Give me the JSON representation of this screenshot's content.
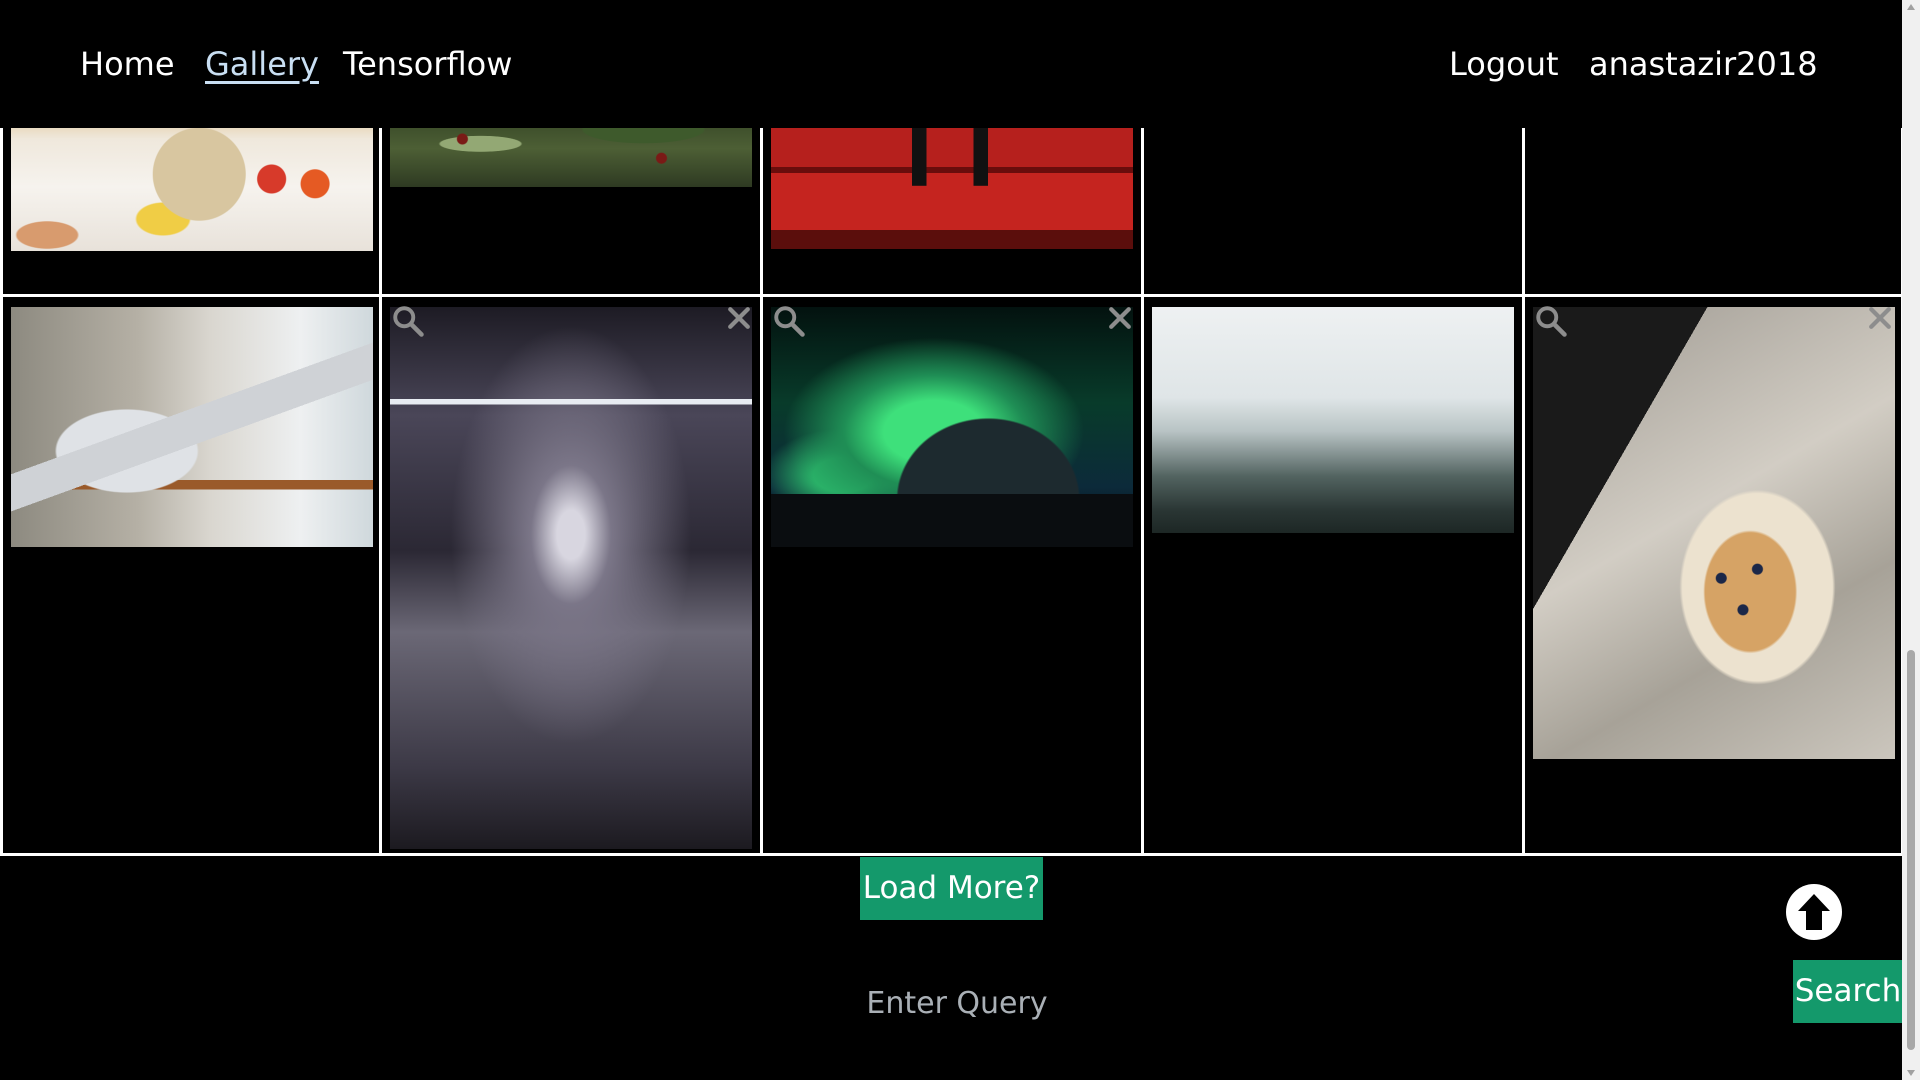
{
  "nav": {
    "home": "Home",
    "gallery": "Gallery",
    "tensorflow": "Tensorflow",
    "logout": "Logout",
    "username": "anastazir2018"
  },
  "gallery": {
    "load_more_label": "Load More?"
  },
  "search": {
    "placeholder": "Enter Query",
    "button_label": "Search"
  },
  "colors": {
    "accent": "#14996b",
    "background": "#000000",
    "border": "#ffffff"
  }
}
